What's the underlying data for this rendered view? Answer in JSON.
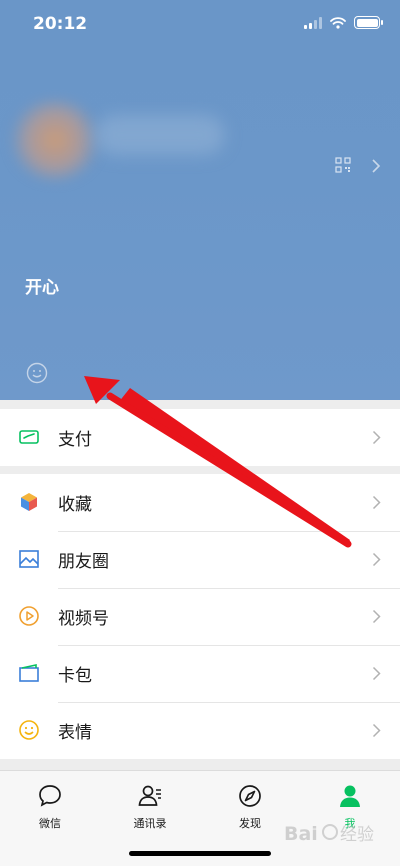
{
  "status_bar": {
    "time": "20:12"
  },
  "profile": {
    "status_text": "开心"
  },
  "menu_groups": [
    {
      "items": [
        {
          "label": "支付",
          "icon": "pay-icon"
        }
      ]
    },
    {
      "items": [
        {
          "label": "收藏",
          "icon": "favorites-icon"
        },
        {
          "label": "朋友圈",
          "icon": "moments-icon"
        },
        {
          "label": "视频号",
          "icon": "channels-icon"
        },
        {
          "label": "卡包",
          "icon": "card-wallet-icon"
        },
        {
          "label": "表情",
          "icon": "stickers-icon"
        }
      ]
    }
  ],
  "tabs": [
    {
      "label": "微信",
      "icon": "chat-bubble-icon",
      "active": false
    },
    {
      "label": "通讯录",
      "icon": "contacts-icon",
      "active": false
    },
    {
      "label": "发现",
      "icon": "compass-icon",
      "active": false
    },
    {
      "label": "我",
      "icon": "person-icon",
      "active": true
    }
  ],
  "colors": {
    "accent": "#07c160",
    "header_blue": "#6b97c9",
    "arrow_red": "#e8141b"
  },
  "watermark": {
    "text": "Bai 经验"
  }
}
